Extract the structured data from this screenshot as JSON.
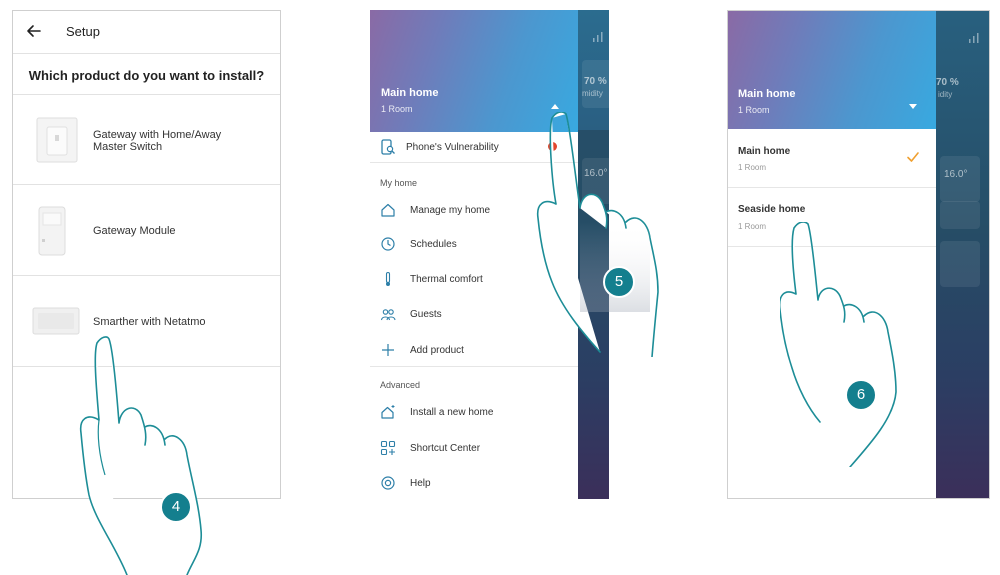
{
  "panel1": {
    "header_title": "Setup",
    "question": "Which product do you want to install?",
    "products": [
      {
        "name_line1": "Gateway with Home/Away",
        "name_line2": "Master Switch",
        "icon": "wall-switch-icon"
      },
      {
        "name_line1": "Gateway Module",
        "name_line2": "",
        "icon": "din-module-icon"
      },
      {
        "name_line1": "Smarther with Netatmo",
        "name_line2": "",
        "icon": "thermostat-icon"
      }
    ],
    "step": "4"
  },
  "panel2": {
    "home_name": "Main home",
    "rooms": "1 Room",
    "vulnerability": "Phone's Vulnerability",
    "section_my_home": "My home",
    "my_home_items": [
      {
        "label": "Manage my home",
        "icon": "house-icon"
      },
      {
        "label": "Schedules",
        "icon": "clock-icon"
      },
      {
        "label": "Thermal comfort",
        "icon": "thermometer-icon"
      },
      {
        "label": "Guests",
        "icon": "guests-icon"
      },
      {
        "label": "Add product",
        "icon": "plus-icon"
      }
    ],
    "section_advanced": "Advanced",
    "advanced_items": [
      {
        "label": "Install a new home",
        "icon": "new-home-icon"
      },
      {
        "label": "Shortcut Center",
        "icon": "shortcut-icon"
      },
      {
        "label": "Help",
        "icon": "help-icon"
      }
    ],
    "bg_humidity": "70 %",
    "bg_humidity_label": "midity",
    "bg_temp": "16.0°",
    "step": "5"
  },
  "panel3": {
    "home_name": "Main home",
    "rooms": "1 Room",
    "homes": [
      {
        "name": "Main home",
        "rooms": "1 Room",
        "selected": true
      },
      {
        "name": "Seaside home",
        "rooms": "1 Room",
        "selected": false
      }
    ],
    "bg_humidity": "70 %",
    "bg_humidity_label": "idity",
    "bg_temp": "16.0°",
    "step": "6"
  },
  "colors": {
    "accent_teal": "#147f8e",
    "check_orange": "#f0a030",
    "alert_red": "#e2462d",
    "header_gradient_start": "#8a6aa5",
    "header_gradient_end": "#38a9e0"
  }
}
